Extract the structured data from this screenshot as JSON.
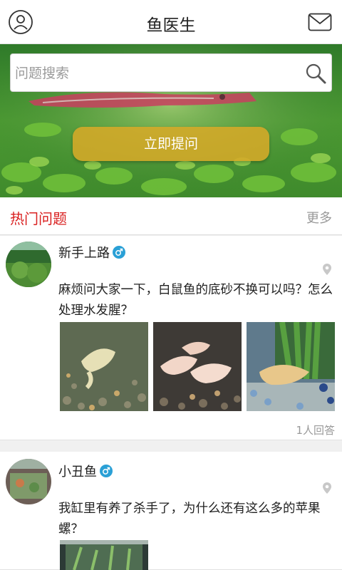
{
  "header": {
    "title": "鱼医生",
    "left_icon": "user-icon",
    "right_icon": "mail-icon"
  },
  "search": {
    "placeholder": "问题搜索",
    "icon": "search-icon"
  },
  "ask_button": {
    "label": "立即提问"
  },
  "hot_section": {
    "title": "热门问题",
    "more_label": "更多",
    "title_color": "#d92020"
  },
  "posts": [
    {
      "user": "新手上路",
      "gender_icon": "male-icon",
      "question": "麻烦问大家一下，白鼠鱼的底砂不换可以吗？怎么处理水发腥？",
      "answers": "1人回答"
    },
    {
      "user": "小丑鱼",
      "gender_icon": "male-icon",
      "question": "我缸里有养了杀手了，为什么还有这么多的苹果螺？"
    }
  ],
  "colors": {
    "accent_gold": "#d6aa28",
    "male_badge": "#2aa0d6"
  }
}
